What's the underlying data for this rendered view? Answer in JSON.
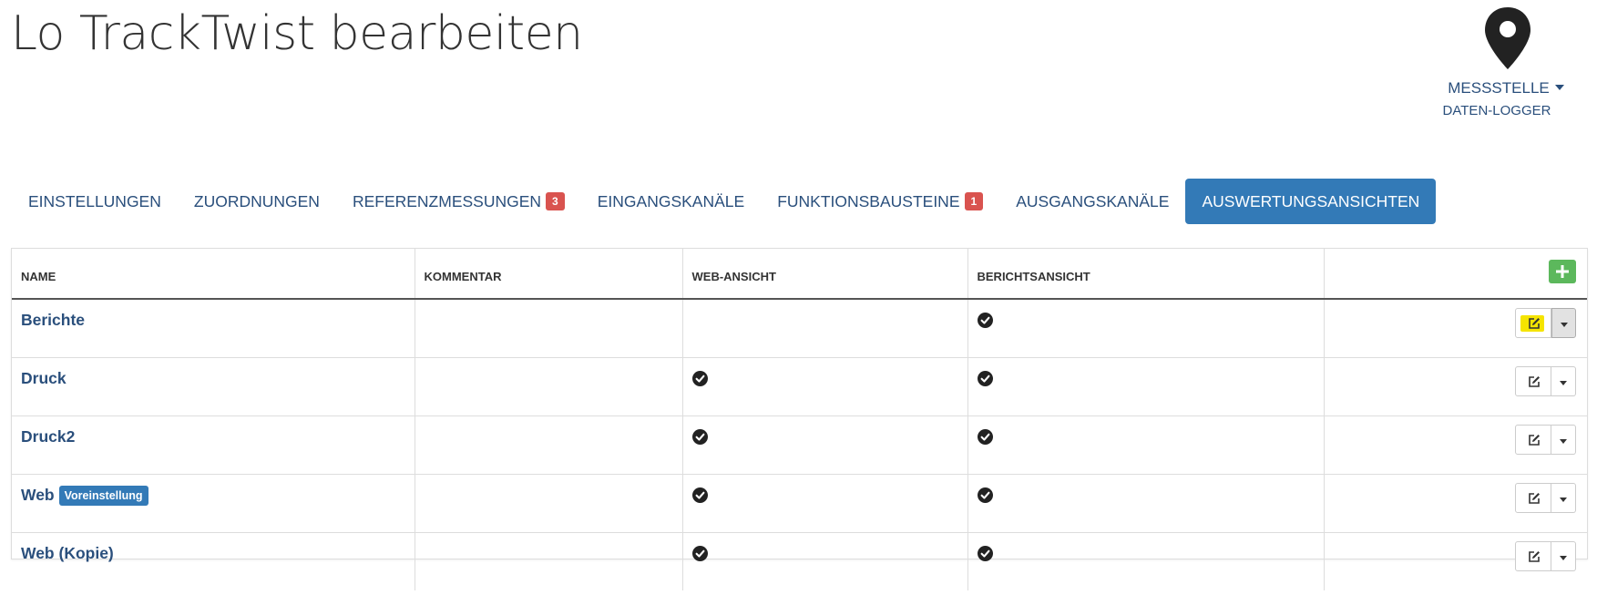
{
  "header": {
    "title": "Lo TrackTwist bearbeiten",
    "location_label": "MESSSTELLE",
    "location_sub": "DATEN-LOGGER"
  },
  "tabs": [
    {
      "label": "EINSTELLUNGEN",
      "badge": null,
      "active": false
    },
    {
      "label": "ZUORDNUNGEN",
      "badge": null,
      "active": false
    },
    {
      "label": "REFERENZMESSUNGEN",
      "badge": "3",
      "active": false
    },
    {
      "label": "EINGANGSKANÄLE",
      "badge": null,
      "active": false
    },
    {
      "label": "FUNKTIONSBAUSTEINE",
      "badge": "1",
      "active": false
    },
    {
      "label": "AUSGANGSKANÄLE",
      "badge": null,
      "active": false
    },
    {
      "label": "AUSWERTUNGSANSICHTEN",
      "badge": null,
      "active": true
    }
  ],
  "table": {
    "columns": [
      "NAME",
      "KOMMENTAR",
      "WEB-ANSICHT",
      "BERICHTSANSICHT"
    ],
    "rows": [
      {
        "name": "Berichte",
        "label": "",
        "comment": "",
        "web": false,
        "report": true
      },
      {
        "name": "Druck",
        "label": "",
        "comment": "",
        "web": true,
        "report": true
      },
      {
        "name": "Druck2",
        "label": "",
        "comment": "",
        "web": true,
        "report": true
      },
      {
        "name": "Web",
        "label": "Voreinstellung",
        "comment": "",
        "web": true,
        "report": true
      },
      {
        "name": "Web (Kopie)",
        "label": "",
        "comment": "",
        "web": true,
        "report": true
      }
    ]
  },
  "icons": {
    "location": "map-pin-icon",
    "add": "plus-icon",
    "edit": "edit-icon",
    "check": "check-circle-icon",
    "dropdown": "caret-down-icon"
  },
  "colors": {
    "link": "#2a4f7c",
    "primary": "#337ab7",
    "badge_danger": "#d9534f",
    "success": "#5cb85c",
    "highlight": "#f5e400"
  }
}
